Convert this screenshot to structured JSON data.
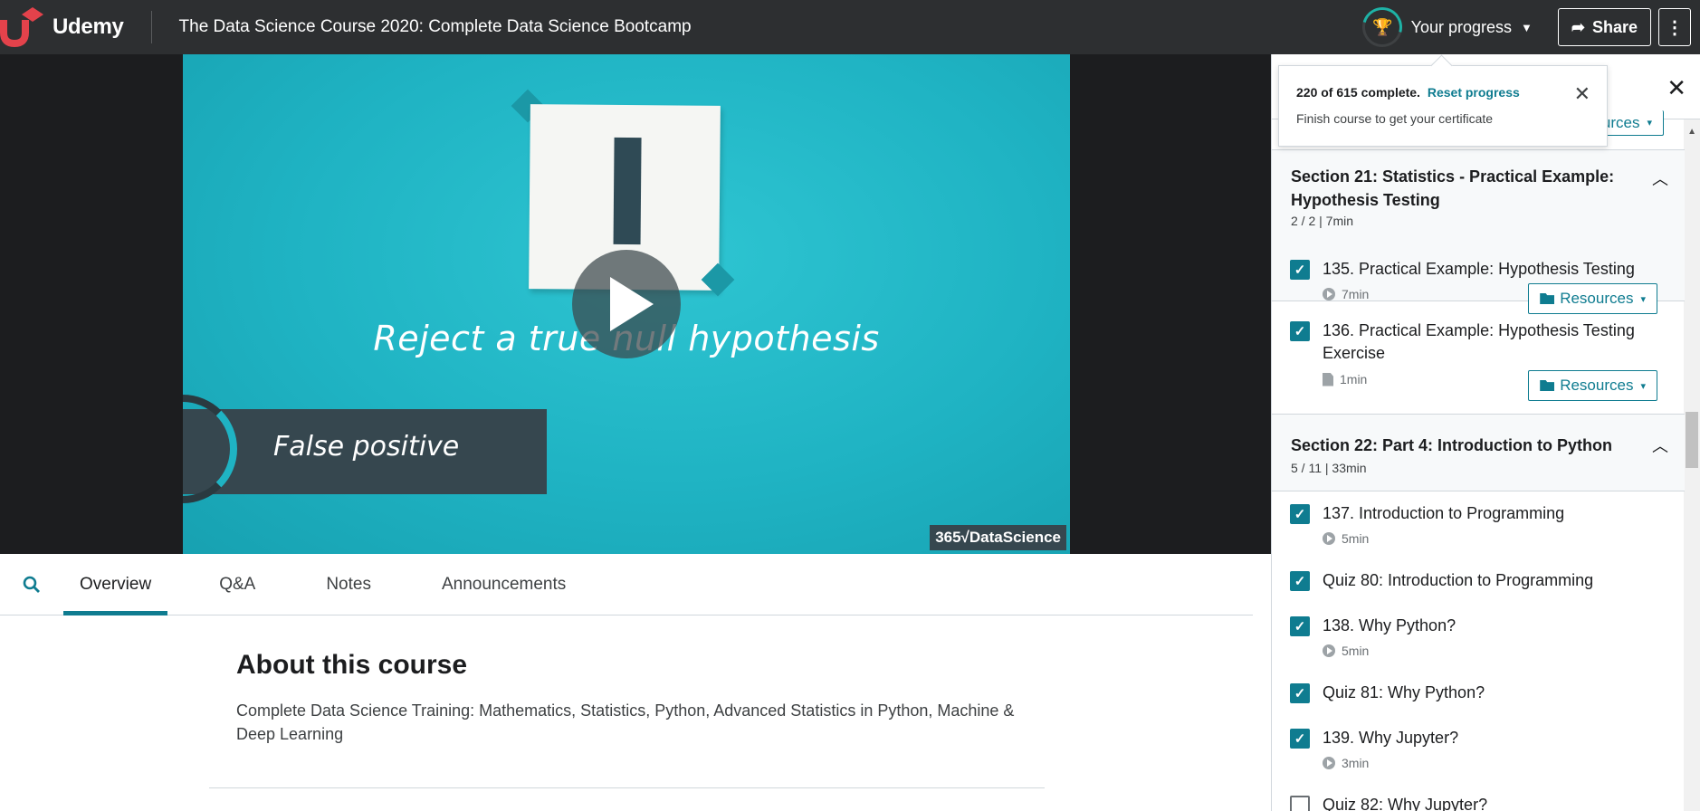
{
  "header": {
    "logo_text": "Udemy",
    "course_title": "The Data Science Course 2020: Complete Data Science Bootcamp",
    "progress_label": "Your progress",
    "share_label": "Share",
    "more_label": "⋮",
    "accent": "#0f7c90"
  },
  "video": {
    "caption": "Reject a true null hypothesis",
    "lower_third": "False positive",
    "watermark": "365√DataScience"
  },
  "tabs": [
    {
      "label": "Overview",
      "active": true
    },
    {
      "label": "Q&A",
      "active": false
    },
    {
      "label": "Notes",
      "active": false
    },
    {
      "label": "Announcements",
      "active": false
    }
  ],
  "about": {
    "heading": "About this course",
    "description": "Complete Data Science Training: Mathematics, Statistics, Python, Advanced Statistics in Python, Machine & Deep Learning"
  },
  "popover": {
    "complete_text": "220 of 615 complete.",
    "reset_label": "Reset progress",
    "certificate_text": "Finish course to get your certificate"
  },
  "sidebar": {
    "partial_resources_label": "sources",
    "sections": [
      {
        "title": "Section 21: Statistics - Practical Example: Hypothesis Testing",
        "meta": "2 / 2 | 7min",
        "items": [
          {
            "label": "135. Practical Example: Hypothesis Testing",
            "duration": "7min",
            "type": "video",
            "checked": true,
            "resources": "Resources"
          },
          {
            "label": "136. Practical Example: Hypothesis Testing Exercise",
            "duration": "1min",
            "type": "file",
            "checked": true,
            "resources": "Resources"
          }
        ]
      },
      {
        "title": "Section 22: Part 4: Introduction to Python",
        "meta": "5 / 11 | 33min",
        "items": [
          {
            "label": "137. Introduction to Programming",
            "duration": "5min",
            "type": "video",
            "checked": true
          },
          {
            "label": "Quiz 80: Introduction to Programming",
            "checked": true
          },
          {
            "label": "138. Why Python?",
            "duration": "5min",
            "type": "video",
            "checked": true
          },
          {
            "label": "Quiz 81: Why Python?",
            "checked": true
          },
          {
            "label": "139. Why Jupyter?",
            "duration": "3min",
            "type": "video",
            "checked": true
          },
          {
            "label": "Quiz 82: Why Jupyter?",
            "checked": false
          }
        ]
      }
    ]
  }
}
